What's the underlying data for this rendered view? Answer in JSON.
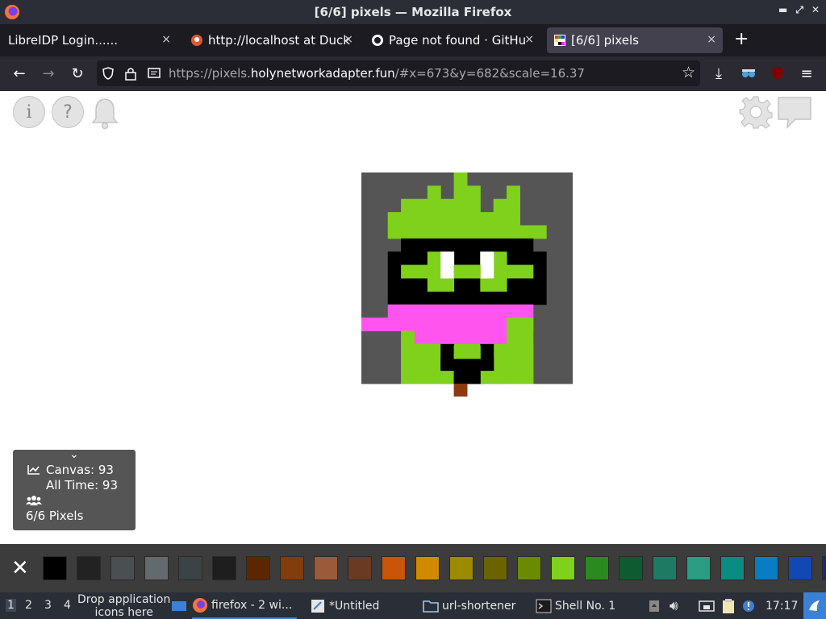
{
  "window": {
    "title": "[6/6] pixels — Mozilla Firefox"
  },
  "tabs": [
    {
      "title": "LibreIDP Login......",
      "close": "×"
    },
    {
      "title": "http://localhost at Duck",
      "close": "×"
    },
    {
      "title": "Page not found · GitHu",
      "close": "×"
    },
    {
      "title": "[6/6] pixels",
      "close": "×"
    }
  ],
  "new_tab_label": "+",
  "url": {
    "prefix": "https://pixels.",
    "domain": "holynetworkadapter.fun",
    "path": "/#x=673&y=682&scale=16.37"
  },
  "stats": {
    "collapse": "⌄",
    "canvas": "Canvas: 93",
    "all_time": "All Time: 93",
    "online": "6/6 Pixels"
  },
  "palette": {
    "close": "✕",
    "colors": [
      "#000000",
      "#222222",
      "#4a4f51",
      "#636a6e",
      "#3d4244",
      "#1e1e1e",
      "#5e2600",
      "#833c0c",
      "#9b5a3a",
      "#6b3a22",
      "#c9550a",
      "#d08a00",
      "#9a8b00",
      "#6a6300",
      "#6b8a00",
      "#7fd11b",
      "#2b8a1e",
      "#0e5b31",
      "#1e7a63",
      "#2a9d82",
      "#0a8c82",
      "#0a7cc4",
      "#1248b4",
      "#1a2a7a"
    ]
  },
  "taskbar": {
    "workspaces": [
      "1",
      "2",
      "3",
      "4"
    ],
    "drop_hint_line1": "Drop application",
    "drop_hint_line2": "icons here",
    "firefox": "firefox - 2 wi...",
    "untitled": "*Untitled",
    "url_shortener": "url-shortener",
    "shell": "Shell No. 1",
    "clock": "17:17"
  },
  "canvas_art": {
    "background": "#555555",
    "green": "#7fd11b",
    "black": "#000000",
    "pink": "#ff55ee",
    "white": "#ffffff",
    "brown": "#8b3a12"
  }
}
